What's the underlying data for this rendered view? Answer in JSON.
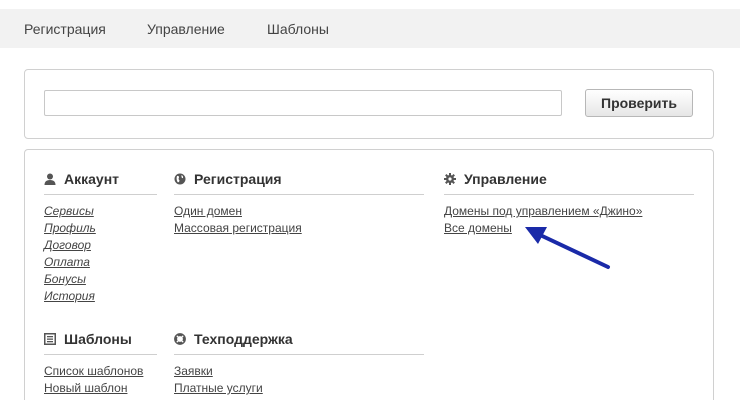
{
  "nav": {
    "tabs": [
      "Регистрация",
      "Управление",
      "Шаблоны"
    ]
  },
  "search": {
    "value": "",
    "button_label": "Проверить"
  },
  "sections": {
    "account": {
      "title": "Аккаунт",
      "icon": "user-icon",
      "links": [
        "Сервисы",
        "Профиль",
        "Договор",
        "Оплата",
        "Бонусы",
        "История"
      ]
    },
    "registration": {
      "title": "Регистрация",
      "icon": "globe-icon",
      "links": [
        "Один домен",
        "Массовая регистрация"
      ]
    },
    "management": {
      "title": "Управление",
      "icon": "gear-icon",
      "links": [
        "Домены под управлением «Джино»",
        "Все домены"
      ]
    },
    "templates": {
      "title": "Шаблоны",
      "icon": "list-icon",
      "links": [
        "Список шаблонов",
        "Новый шаблон"
      ]
    },
    "support": {
      "title": "Техподдержка",
      "icon": "lifebuoy-icon",
      "links": [
        "Заявки",
        "Платные услуги"
      ]
    }
  },
  "annotation": {
    "arrow_color": "#1a2aa8"
  }
}
